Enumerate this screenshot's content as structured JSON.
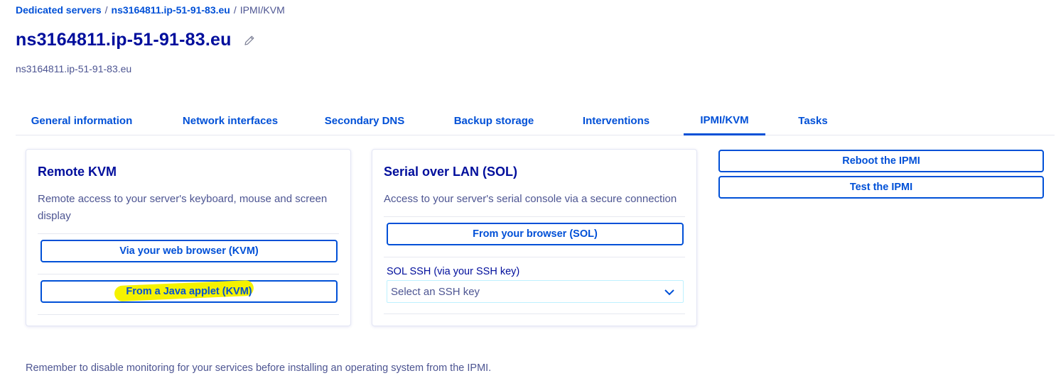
{
  "breadcrumb": {
    "items": [
      "Dedicated servers",
      "ns3164811.ip-51-91-83.eu"
    ],
    "separator": "/",
    "current": "IPMI/KVM"
  },
  "page": {
    "title": "ns3164811.ip-51-91-83.eu",
    "subtitle": "ns3164811.ip-51-91-83.eu"
  },
  "tabs": [
    {
      "label": "General information",
      "active": false
    },
    {
      "label": "Network interfaces",
      "active": false
    },
    {
      "label": "Secondary DNS",
      "active": false
    },
    {
      "label": "Backup storage",
      "active": false
    },
    {
      "label": "Interventions",
      "active": false
    },
    {
      "label": "IPMI/KVM",
      "active": true
    },
    {
      "label": "Tasks",
      "active": false
    }
  ],
  "remote_kvm": {
    "title": "Remote KVM",
    "description": "Remote access to your server's keyboard, mouse and screen display",
    "browser_button": "Via your web browser (KVM)",
    "java_button": "From a Java applet (KVM)"
  },
  "sol": {
    "title": "Serial over LAN (SOL)",
    "description": "Access to your server's serial console via a secure connection",
    "browser_button": "From your browser (SOL)",
    "ssh_label": "SOL SSH (via your SSH key)",
    "ssh_select_placeholder": "Select an SSH key"
  },
  "actions": {
    "reboot": "Reboot the IPMI",
    "test": "Test the IPMI"
  },
  "footer_note": "Remember to disable monitoring for your services before installing an operating system from the IPMI.",
  "colors": {
    "primary": "#0050d7",
    "title": "#000e9c",
    "text": "#4d5592",
    "highlight": "#f5f200"
  },
  "icons": {
    "edit": "pencil-icon",
    "select": "chevron-down-icon"
  }
}
